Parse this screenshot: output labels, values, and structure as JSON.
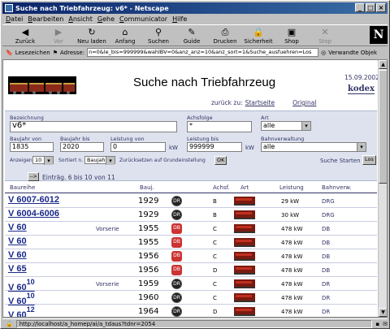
{
  "window": {
    "title": "Suche nach Triebfahrzeug: v6* - Netscape"
  },
  "menu": [
    "Datei",
    "Bearbeiten",
    "Ansicht",
    "Gehe",
    "Communicator",
    "Hilfe"
  ],
  "toolbar": [
    {
      "label": "Zurück",
      "icon": "back-arrow-icon",
      "glyph": "◀",
      "enabled": true
    },
    {
      "label": "Vor",
      "icon": "forward-arrow-icon",
      "glyph": "▶",
      "enabled": false
    },
    {
      "label": "Neu laden",
      "icon": "reload-icon",
      "glyph": "↻",
      "enabled": true
    },
    {
      "label": "Anfang",
      "icon": "home-icon",
      "glyph": "⌂",
      "enabled": true
    },
    {
      "label": "Suchen",
      "icon": "search-icon",
      "glyph": "⚲",
      "enabled": true
    },
    {
      "label": "Guide",
      "icon": "guide-icon",
      "glyph": "✎",
      "enabled": true
    },
    {
      "label": "Drucken",
      "icon": "print-icon",
      "glyph": "⎙",
      "enabled": true
    },
    {
      "label": "Sicherheit",
      "icon": "lock-icon",
      "glyph": "🔒",
      "enabled": true
    },
    {
      "label": "Shop",
      "icon": "shop-icon",
      "glyph": "▣",
      "enabled": true
    },
    {
      "label": "Stop",
      "icon": "stop-icon",
      "glyph": "✕",
      "enabled": false
    }
  ],
  "location": {
    "bookmarks": "Lesezeichen",
    "label": "Adresse:",
    "url": "n=0&le_bis=999999&wahlBV=0&anz_anz=10&anz_sort=1&Suche_ausfuehren=Los",
    "related": "Verwandte Objek"
  },
  "page": {
    "title": "Suche nach Triebfahrzeug",
    "date": "15.09.2002",
    "logo": "kodex",
    "back_prefix": "zurück zu:",
    "link_start": "Startseite",
    "link_original": "Original"
  },
  "form": {
    "bezeichnung_label": "Bezeichnung",
    "bezeichnung_value": "v6*",
    "achsfolge_label": "Achsfolge",
    "achsfolge_value": "*",
    "art_label": "Art",
    "art_value": "alle",
    "baujahr_von_label": "Baujahr von",
    "baujahr_von_value": "1835",
    "baujahr_bis_label": "Baujahr bis",
    "baujahr_bis_value": "2020",
    "leistung_von_label": "Leistung von",
    "leistung_von_value": "0",
    "leistung_bis_label": "Leistung bis",
    "leistung_bis_value": "999999",
    "kw": "kW",
    "bahnverwaltung_label": "Bahnverwaltung",
    "bahnverwaltung_value": "alle",
    "anzeigen_label": "Anzeigen",
    "anzeigen_value": "10",
    "sortiert_label": "Sortiert n.",
    "sortiert_value": "Baujahr",
    "reset_label": "Zurücksetzen auf Grundeinstellung",
    "ok": "OK",
    "suche_label": "Suche Starten",
    "los": "Los"
  },
  "nav": {
    "arrow": "-->",
    "text": "Einträg. 6 bis 10 von 11"
  },
  "columns": [
    "Baureihe",
    "Bauj.",
    "Achsf.",
    "Art",
    "Leistung",
    "Bahnverw."
  ],
  "rows": [
    {
      "name": "V 6007-6012",
      "sup": "",
      "variant": "",
      "year": "1929",
      "ep": "DR",
      "ep_type": "dr",
      "axle": "B",
      "power": "29 kW",
      "bv": "DRG"
    },
    {
      "name": "V 6004-6006",
      "sup": "",
      "variant": "",
      "year": "1929",
      "ep": "DR",
      "ep_type": "dr",
      "axle": "B",
      "power": "30 kW",
      "bv": "DRG"
    },
    {
      "name": "V 60",
      "sup": "",
      "variant": "Vorserie",
      "year": "1955",
      "ep": "DB",
      "ep_type": "db",
      "axle": "C",
      "power": "478 kW",
      "bv": "DB"
    },
    {
      "name": "V 60",
      "sup": "",
      "variant": "",
      "year": "1955",
      "ep": "DB",
      "ep_type": "db",
      "axle": "C",
      "power": "478 kW",
      "bv": "DB"
    },
    {
      "name": "V 60",
      "sup": "",
      "variant": "",
      "year": "1956",
      "ep": "DB",
      "ep_type": "db",
      "axle": "C",
      "power": "478 kW",
      "bv": "DB"
    },
    {
      "name": "V 65",
      "sup": "",
      "variant": "",
      "year": "1956",
      "ep": "DB",
      "ep_type": "db",
      "axle": "D",
      "power": "478 kW",
      "bv": "DB"
    },
    {
      "name": "V 60",
      "sup": "10",
      "variant": "Vorserie",
      "year": "1959",
      "ep": "DR",
      "ep_type": "dr",
      "axle": "C",
      "power": "478 kW",
      "bv": "DR"
    },
    {
      "name": "V 60",
      "sup": "10",
      "variant": "",
      "year": "1960",
      "ep": "DR",
      "ep_type": "dr",
      "axle": "C",
      "power": "478 kW",
      "bv": "DR"
    },
    {
      "name": "V 60",
      "sup": "12",
      "variant": "",
      "year": "1964",
      "ep": "DR",
      "ep_type": "dr",
      "axle": "D",
      "power": "478 kW",
      "bv": "DR"
    }
  ],
  "status": {
    "url": "http://localhost/a_homep/ai/a_tdaus?tdnr=2054"
  }
}
